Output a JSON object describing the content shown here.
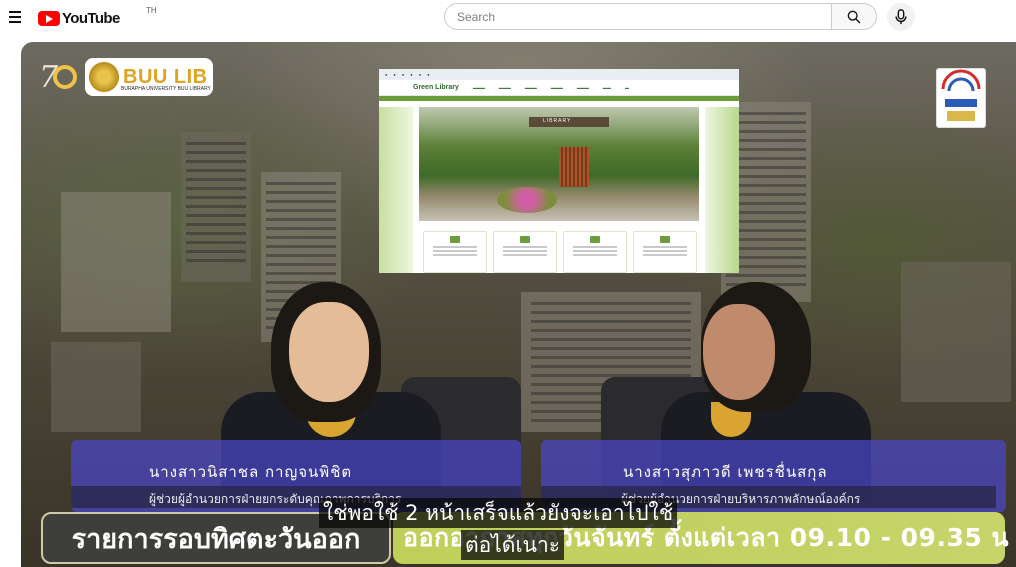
{
  "header": {
    "logo_text": "YouTube",
    "logo_country": "TH",
    "search_placeholder": "Search",
    "search_icon": "search-icon",
    "mic_icon": "mic-icon",
    "menu_icon": "hamburger-menu-icon"
  },
  "video": {
    "channel_logo": "BUU LIB",
    "channel_logo_sub": "BURAPHA UNIVERSITY  BUU LIBRARY",
    "inset_site": {
      "title": "Green Library",
      "hero_sign": "LIBRARY"
    },
    "guests": [
      {
        "name": "นางสาวนิสาชล กาญจนพิชิต",
        "role": "ผู้ช่วยผู้อำนวยการฝ่ายยกระดับคุณภาพการบริการ"
      },
      {
        "name": "นางสาวสุภาวดี เพชรชื่นสกุล",
        "role": "ผู้ช่วยผู้อำนวยการฝ่ายบริหารภาพลักษณ์องค์กร"
      }
    ],
    "program_title": "รายการรอบทิศตะวันออก",
    "program_schedule": "ออกอากาศทุกวันจันทร์ ตั้งแต่เวลา 09.10 - 09.35 น",
    "captions": [
      "ใช่พอใช้ 2 หน้าเสร็จแล้วยังจะเอาไปใช้",
      "ต่อได้เนาะ"
    ]
  },
  "colors": {
    "youtube_red": "#ff0000",
    "banner_blue": "#4a46c8",
    "program_green": "#c2d160",
    "buu_gold": "#e0a324"
  }
}
